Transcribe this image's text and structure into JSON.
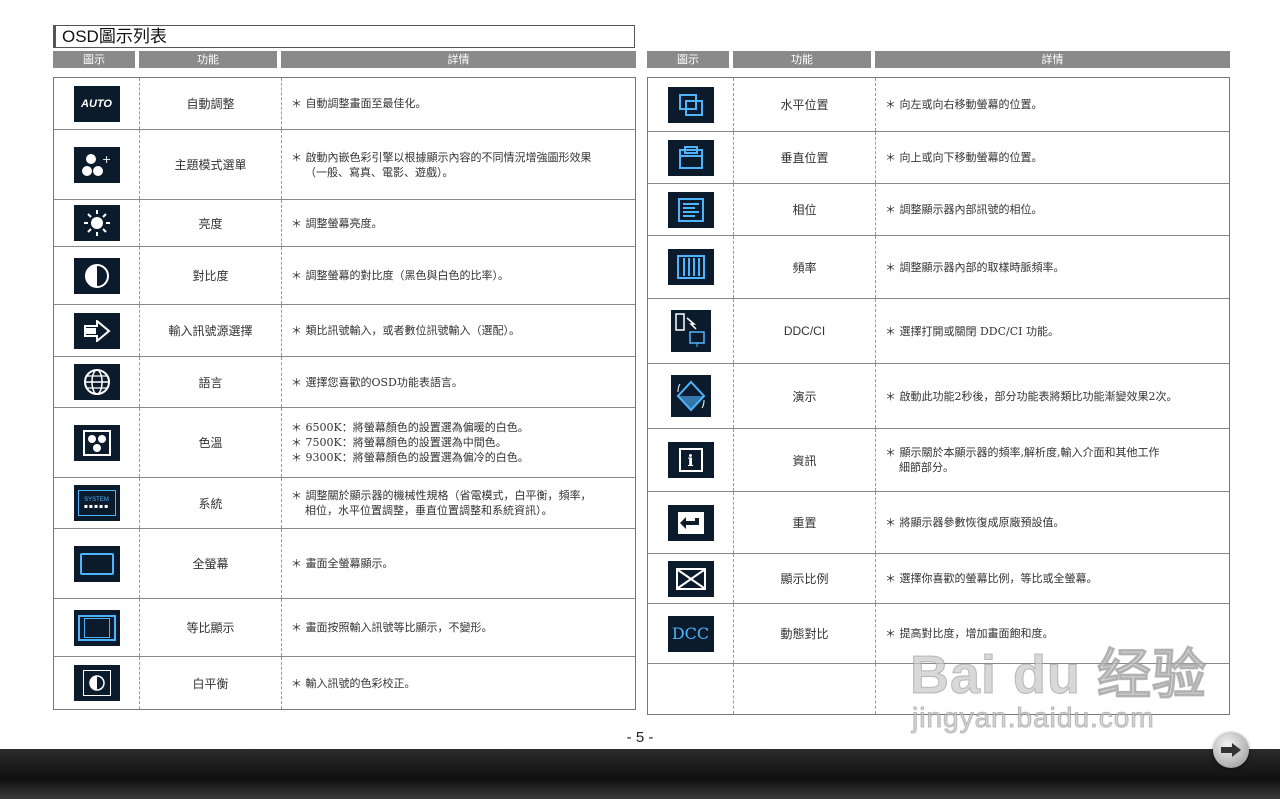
{
  "page": {
    "title": "OSD圖示列表",
    "page_number": "- 5 -"
  },
  "header": {
    "icon": "圖示",
    "function": "功能",
    "details": "詳情"
  },
  "left_rows": [
    {
      "icon": "auto-icon",
      "icon_text": "AUTO",
      "function": "自動調整",
      "details": [
        "＊ 自動調整畫面至最佳化。"
      ]
    },
    {
      "icon": "theme-mode-icon",
      "function": "主題模式選單",
      "details": [
        "＊ 啟動內嵌色彩引擎以根據顯示內容的不同情況增強圖形效果",
        "（一般、寫真、電影、遊戲）。"
      ]
    },
    {
      "icon": "brightness-icon",
      "function": "亮度",
      "details": [
        "＊ 調整螢幕亮度。"
      ]
    },
    {
      "icon": "contrast-icon",
      "function": "對比度",
      "details": [
        "＊ 調整螢幕的對比度（黑色與白色的比率）。"
      ]
    },
    {
      "icon": "input-source-icon",
      "function": "輸入訊號源選擇",
      "details": [
        "＊ 類比訊號輸入，或者數位訊號輸入（選配）。"
      ]
    },
    {
      "icon": "language-icon",
      "function": "語言",
      "details": [
        "＊ 選擇您喜歡的OSD功能表語言。"
      ]
    },
    {
      "icon": "color-temp-icon",
      "function": "色溫",
      "details": [
        "＊ 6500K：將螢幕顏色的設置選為偏暖的白色。",
        "＊ 7500K：將螢幕顏色的設置選為中間色。",
        "＊ 9300K：將螢幕顏色的設置選為偏冷的白色。"
      ]
    },
    {
      "icon": "system-icon",
      "icon_text": "SYSTEM",
      "function": "系統",
      "details": [
        "＊ 調整關於顯示器的機械性規格（省電模式，白平衡，頻率，",
        "相位，水平位置調整，垂直位置調整和系統資訊）。"
      ]
    },
    {
      "icon": "full-screen-icon",
      "function": "全螢幕",
      "details": [
        "＊ 畫面全螢幕顯示。"
      ]
    },
    {
      "icon": "aspect-display-icon",
      "function": "等比顯示",
      "details": [
        "＊ 畫面按照輸入訊號等比顯示，不變形。"
      ]
    },
    {
      "icon": "white-balance-icon",
      "function": "白平衡",
      "details": [
        "＊ 輸入訊號的色彩校正。"
      ]
    }
  ],
  "right_rows": [
    {
      "icon": "h-position-icon",
      "function": "水平位置",
      "details": [
        "＊ 向左或向右移動螢幕的位置。"
      ]
    },
    {
      "icon": "v-position-icon",
      "function": "垂直位置",
      "details": [
        "＊ 向上或向下移動螢幕的位置。"
      ]
    },
    {
      "icon": "phase-icon",
      "function": "相位",
      "details": [
        "＊ 調整顯示器內部訊號的相位。"
      ]
    },
    {
      "icon": "frequency-icon",
      "function": "頻率",
      "details": [
        "＊ 調整顯示器內部的取樣時脈頻率。"
      ]
    },
    {
      "icon": "ddc-ci-icon",
      "function": "DDC/CI",
      "details": [
        "＊ 選擇打開或關閉 DDC/CI 功能。"
      ]
    },
    {
      "icon": "demo-icon",
      "function": "演示",
      "details": [
        "＊ 啟動此功能2秒後，部分功能表將類比功能漸變效果2次。"
      ]
    },
    {
      "icon": "info-icon",
      "function": "資訊",
      "details": [
        "＊ 顯示關於本顯示器的頻率,解析度,輸入介面和其他工作",
        "細節部分。"
      ]
    },
    {
      "icon": "reset-icon",
      "function": "重置",
      "details": [
        "＊ 將顯示器參數恢復成原廠預設值。"
      ]
    },
    {
      "icon": "display-ratio-icon",
      "function": "顯示比例",
      "details": [
        "＊ 選擇你喜歡的螢幕比例，等比或全螢幕。"
      ]
    },
    {
      "icon": "dcc-icon",
      "icon_text": "DCC",
      "function": "動態對比",
      "details": [
        "＊ 提高對比度，增加畫面飽和度。"
      ]
    },
    {
      "icon": "",
      "function": "",
      "details": []
    }
  ],
  "watermark": {
    "brand": "Bai du 经验",
    "url": "jingyan.baidu.com"
  },
  "colors": {
    "header_bg": "#8a8a8a",
    "icon_bg": "#0b1b2b",
    "icon_fg": "#4fb4ff",
    "footer_bg": "#1a1a1a"
  }
}
